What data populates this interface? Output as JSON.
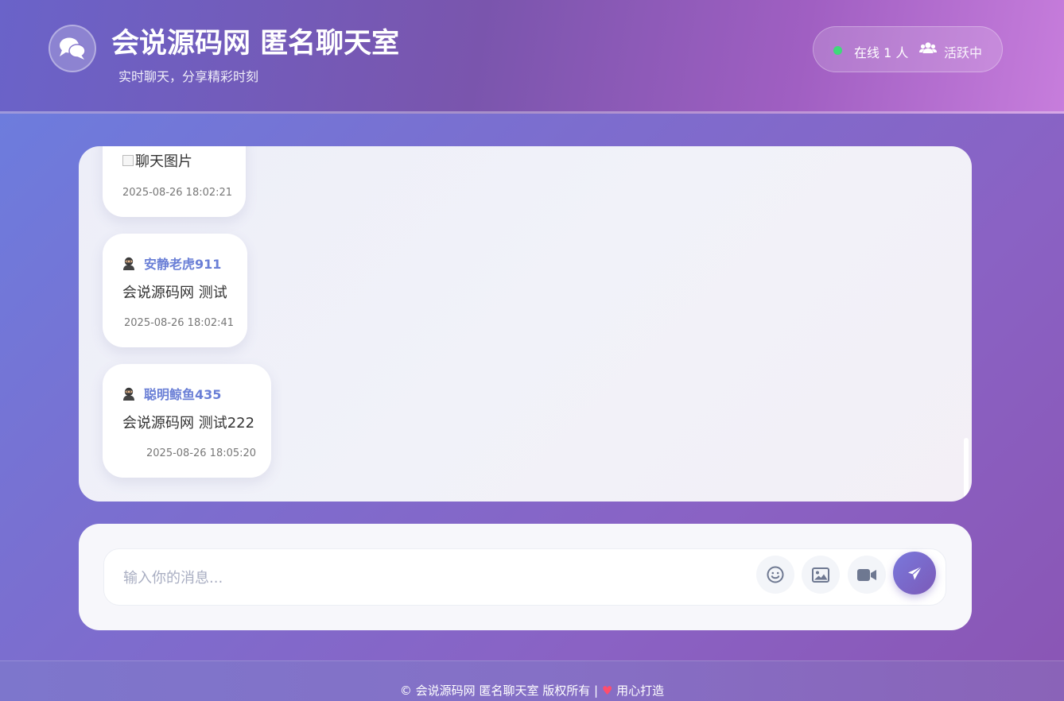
{
  "header": {
    "title": "会说源码网 匿名聊天室",
    "subtitle": "实时聊天，分享精彩时刻",
    "online_text": "在线 1 人",
    "active_text": "活跃中",
    "logo_icon": "chat-bubbles-icon",
    "users_icon": "users-icon",
    "online_dot_color": "#3fd97a"
  },
  "messages": [
    {
      "type": "image",
      "image_alt": "聊天图片",
      "time": "2025-08-26 18:02:21"
    },
    {
      "type": "text",
      "avatar_icon": "ninja-avatar-icon",
      "username": "安静老虎911",
      "text": "会说源码网 测试",
      "time": "2025-08-26 18:02:41"
    },
    {
      "type": "text",
      "avatar_icon": "ninja-avatar-icon",
      "username": "聪明鲸鱼435",
      "text": "会说源码网 测试222",
      "time": "2025-08-26 18:05:20"
    }
  ],
  "composer": {
    "placeholder": "输入你的消息...",
    "value": "",
    "emoji_icon": "smile-icon",
    "image_icon": "image-icon",
    "video_icon": "video-camera-icon",
    "send_icon": "paper-plane-icon"
  },
  "footer": {
    "copyright": "© 会说源码网 匿名聊天室 版权所有 |",
    "heart": "♥",
    "tagline": "用心打造"
  },
  "colors": {
    "accent": "#6a7fd6",
    "send_button": "#7a6ad0"
  }
}
